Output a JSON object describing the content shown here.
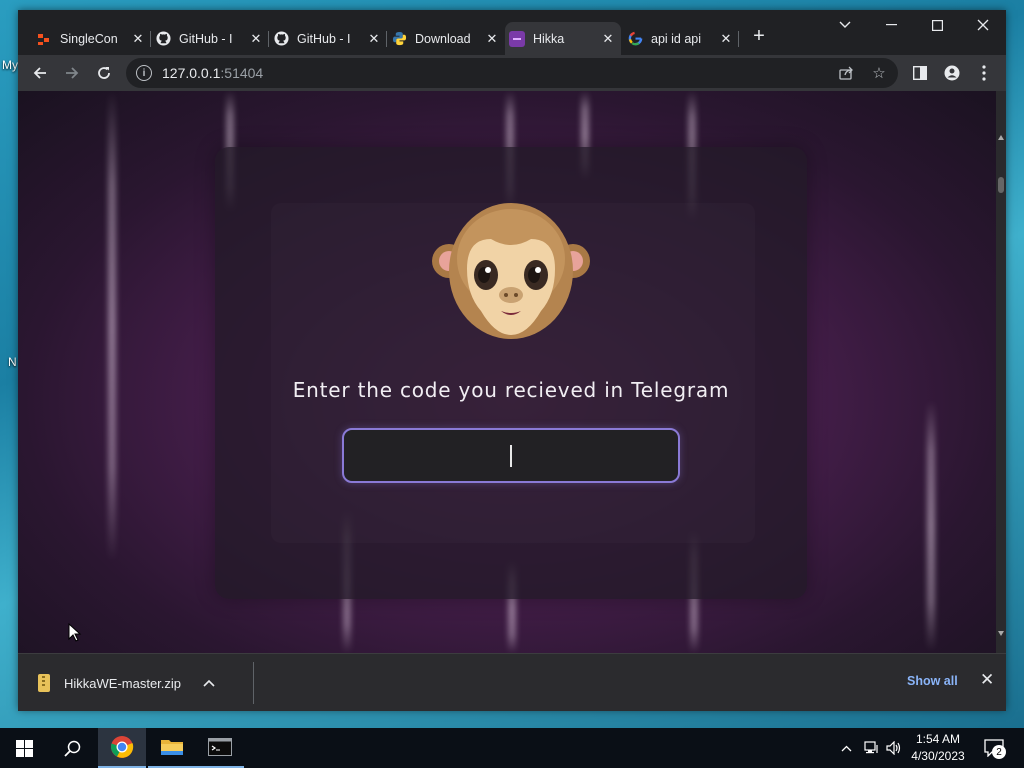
{
  "desktop": {
    "icon_labels": [
      "My",
      "N"
    ]
  },
  "browser": {
    "tabs": [
      {
        "title": "SingleCon",
        "icon": "singlecon-favicon",
        "active": false
      },
      {
        "title": "GitHub - I",
        "icon": "github-icon",
        "active": false
      },
      {
        "title": "GitHub - I",
        "icon": "github-icon",
        "active": false
      },
      {
        "title": "Download",
        "icon": "python-icon",
        "active": false
      },
      {
        "title": "Hikka",
        "icon": "hikka-favicon",
        "active": true
      },
      {
        "title": "api id api",
        "icon": "google-icon",
        "active": false
      }
    ],
    "new_tab_label": "+",
    "address": {
      "host": "127.0.0.1",
      "port": ":51404"
    }
  },
  "page": {
    "prompt": "Enter the code you recieved in Telegram",
    "code_input": {
      "value": "",
      "placeholder": ""
    }
  },
  "downloads": {
    "file_name": "HikkaWE-master.zip",
    "show_all_label": "Show all"
  },
  "taskbar": {
    "time": "1:54 AM",
    "date": "4/30/2023",
    "notification_count": "2"
  },
  "colors": {
    "input_border": "#8a7ad6",
    "show_all_link": "#8ab4f8",
    "page_glow": "#6e2a6c"
  }
}
